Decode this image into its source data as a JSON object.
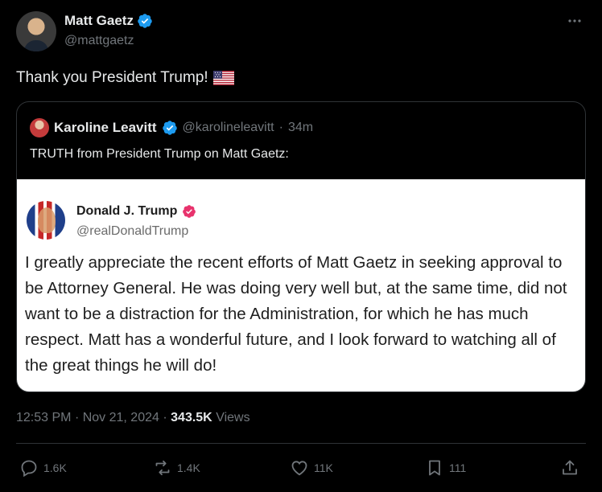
{
  "author": {
    "name": "Matt Gaetz",
    "handle": "@mattgaetz"
  },
  "tweet": {
    "text": "Thank you President Trump!",
    "flag_emoji_icon": "us-flag-icon"
  },
  "quote": {
    "name": "Karoline Leavitt",
    "handle": "@karolineleavitt",
    "separator": "·",
    "time": "34m",
    "text": "TRUTH from President Trump on Matt Gaetz:",
    "truth": {
      "name": "Donald J. Trump",
      "handle": "@realDonaldTrump",
      "body": "I greatly appreciate the recent efforts of Matt Gaetz in seeking approval to be Attorney General. He was doing very well but, at the same time, did not want to be a distraction for the Administration, for which he has much respect. Matt has a wonderful future, and I look forward to watching all of the great things he will do!"
    }
  },
  "meta": {
    "time": "12:53 PM",
    "sep": "·",
    "date": "Nov 21, 2024",
    "sep2": "·",
    "views_count": "343.5K",
    "views_label": "Views"
  },
  "actions": {
    "replies": "1.6K",
    "reposts": "1.4K",
    "likes": "11K",
    "bookmarks": "111"
  },
  "colors": {
    "background": "#000000",
    "verified_blue": "#1d9bf0",
    "truth_badge": "#e8336d",
    "muted": "#71767b"
  }
}
